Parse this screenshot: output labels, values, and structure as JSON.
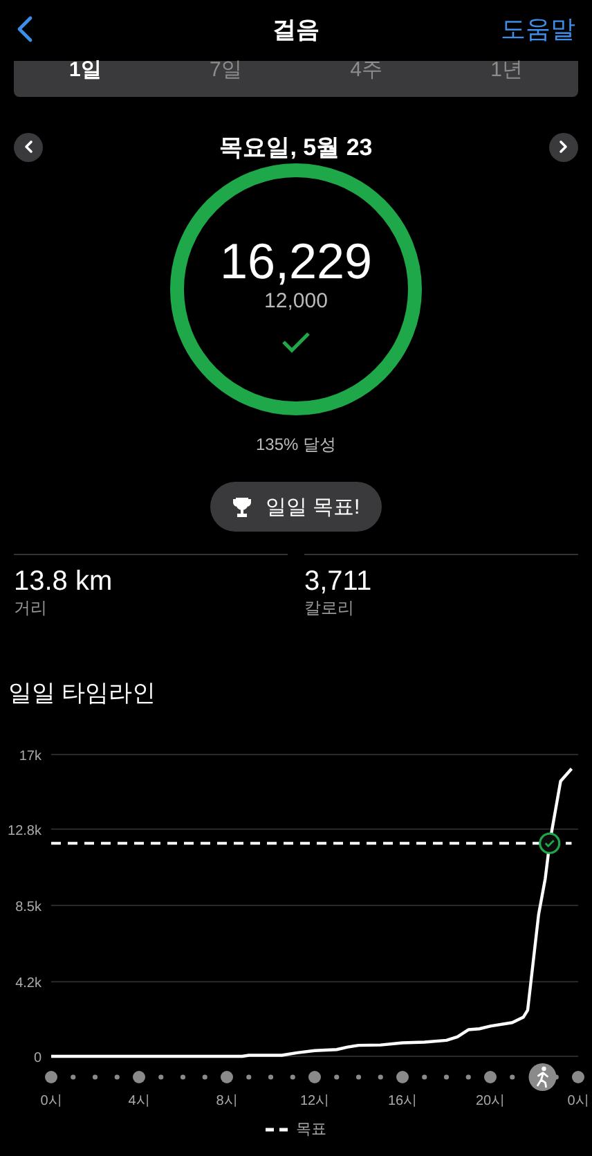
{
  "nav": {
    "title": "걸음",
    "help": "도움말"
  },
  "tabs": [
    {
      "label": "1일",
      "selected": true
    },
    {
      "label": "7일",
      "selected": false
    },
    {
      "label": "4주",
      "selected": false
    },
    {
      "label": "1년",
      "selected": false
    }
  ],
  "date": {
    "label": "목요일, 5월 23"
  },
  "ring": {
    "steps": "16,229",
    "goal": "12,000",
    "level": 1,
    "goal_met": true
  },
  "achievement": "135% 달성",
  "badge_button": {
    "label": "일일 목표!"
  },
  "stats": [
    {
      "value": "13.8 km",
      "label": "거리"
    },
    {
      "value": "3,711",
      "label": "칼로리"
    }
  ],
  "timeline": {
    "title": "일일 타임라인",
    "axis_end_label": "0시",
    "chart_data": {
      "type": "line",
      "x": [
        0,
        8.7,
        9,
        10.5,
        11.2,
        12,
        13,
        13.5,
        14,
        15,
        16,
        17,
        18,
        18.5,
        19,
        19.5,
        20,
        21,
        21.5,
        21.7,
        22.2,
        22.5,
        22.7,
        23.2,
        23.7
      ],
      "series": [
        {
          "color": "#ffffff",
          "line_style": "solid",
          "values": [
            0,
            0,
            60,
            60,
            200,
            320,
            380,
            520,
            620,
            640,
            760,
            800,
            900,
            1100,
            1500,
            1550,
            1700,
            1900,
            2200,
            2600,
            8000,
            10000,
            12000,
            15500,
            16200
          ]
        },
        {
          "name": "목표",
          "color": "#ffffff",
          "line_style": "dashed",
          "values": [
            12000,
            12000,
            12000,
            12000,
            12000,
            12000,
            12000,
            12000,
            12000,
            12000,
            12000,
            12000,
            12000,
            12000,
            12000,
            12000,
            12000,
            12000,
            12000,
            12000,
            12000,
            12000,
            12000,
            12000,
            12000
          ]
        }
      ],
      "grid": true,
      "xlim": [
        0,
        24
      ],
      "ylim": [
        0,
        17000
      ],
      "xticks": [
        {
          "value": 0,
          "label": "0시"
        },
        {
          "value": 4,
          "label": "4시"
        },
        {
          "value": 8,
          "label": "8시"
        },
        {
          "value": 12,
          "label": "12시"
        },
        {
          "value": 16,
          "label": "16시"
        },
        {
          "value": 20,
          "label": "20시"
        }
      ],
      "yticks": [
        {
          "value": 0,
          "label": "0"
        },
        {
          "value": 4200,
          "label": "4.2k"
        },
        {
          "value": 8500,
          "label": "8.5k"
        },
        {
          "value": 12800,
          "label": "12.8k"
        },
        {
          "value": 17000,
          "label": "17k"
        }
      ]
    }
  }
}
